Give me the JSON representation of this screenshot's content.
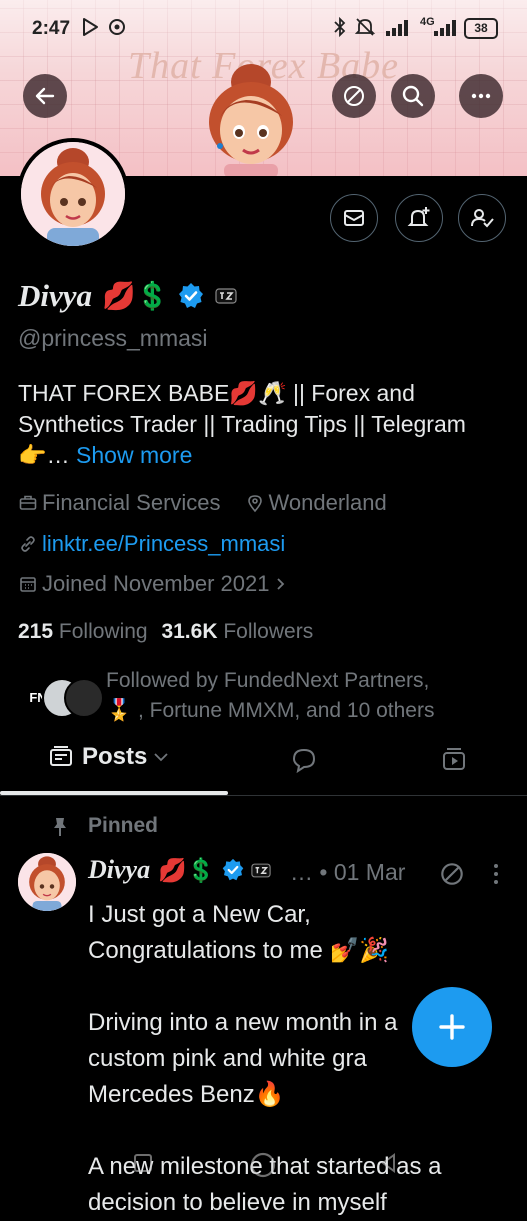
{
  "status_bar": {
    "time": "2:47",
    "network": "4G",
    "battery": "38"
  },
  "banner": {
    "title": "That Forex Babe"
  },
  "top_actions": [
    "back-icon",
    "promote-icon",
    "search-icon",
    "more-icon"
  ],
  "profile": {
    "display_name": "Divya",
    "name_emojis": "💋💲",
    "handle": "@princess_mmasi",
    "bio": "THAT FOREX BABE💋🥂 || Forex and Synthetics Trader || Trading Tips || Telegram👉…",
    "show_more": "Show more",
    "category": "Financial Services",
    "location": "Wonderland",
    "link": "linktr.ee/Princess_mmasi",
    "joined": "Joined November 2021",
    "following_count": "215",
    "following_label": "Following",
    "followers_count": "31.6K",
    "followers_label": "Followers",
    "followed_by_line1": "Followed by FundedNext Partners,",
    "followed_by_line2": "🎖️ , Fortune MMXM, and 10 others",
    "followed_avatar_text": "FN"
  },
  "tabs": {
    "posts_label": "Posts"
  },
  "tweet": {
    "pinned_label": "Pinned",
    "author_name": "Divya",
    "author_emojis": "💋💲",
    "meta": "… • 01 Mar",
    "text": "I Just got a New Car,\nCongratulations to me 💅🎉\n\nDriving into a new month in a\ncustom pink and white gra\nMercedes Benz🔥\n\nA new milestone that started as a\ndecision to believe in myself"
  },
  "colors": {
    "accent": "#1d9bf0",
    "background": "#000000",
    "text_primary": "#e7e9ea",
    "text_secondary": "#71767b",
    "banner_pink": "#f6d7d9"
  }
}
